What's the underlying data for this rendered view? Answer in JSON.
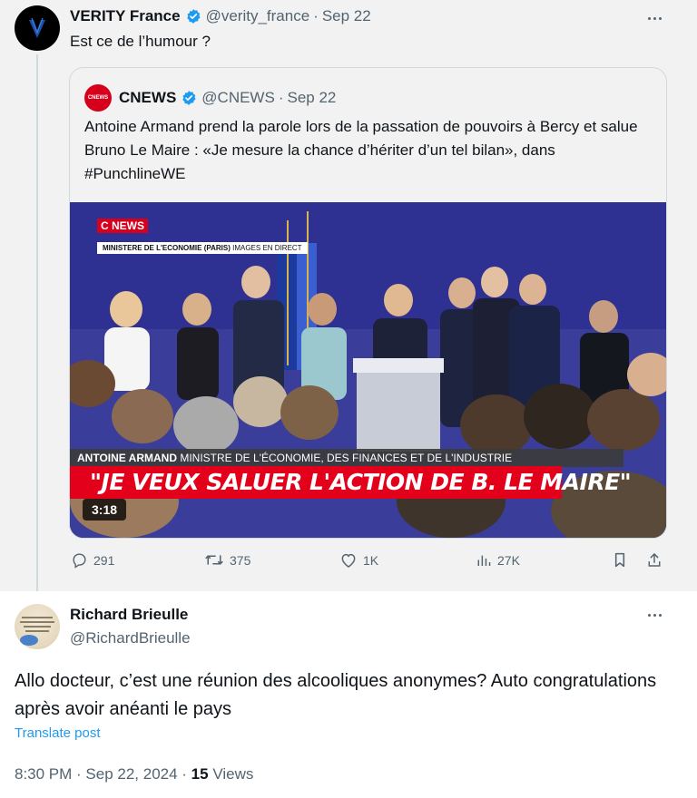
{
  "parent_tweet": {
    "name": "VERITY France",
    "handle": "@verity_france",
    "date": "Sep 22",
    "text": "Est ce de l’humour ?"
  },
  "quoted_tweet": {
    "name": "CNEWS",
    "avatar_label": "CNEWS",
    "handle": "@CNEWS",
    "date": "Sep 22",
    "text": "Antoine Armand prend la parole lors de la passation de pouvoirs à Bercy et salue Bruno Le Maire : «Je mesure la chance d’hériter d’un tel bilan», dans #PunchlineWE",
    "video": {
      "channel_logo": "C NEWS",
      "location_bold": "MINISTERE DE L'ECONOMIE (PARIS)",
      "location_light": "IMAGES EN DIRECT",
      "speaker_name": "ANTOINE ARMAND",
      "speaker_title": "MINISTRE DE L'ÉCONOMIE, DES FINANCES ET DE L'INDUSTRIE",
      "headline": "\"JE VEUX SALUER L'ACTION DE B. LE MAIRE\"",
      "duration": "3:18"
    }
  },
  "actions": {
    "replies": "291",
    "reposts": "375",
    "likes": "1K",
    "views": "27K"
  },
  "reply_tweet": {
    "name": "Richard Brieulle",
    "handle": "@RichardBrieulle",
    "text": "Allo docteur, c’est une réunion des alcooliques anonymes? Auto congratulations après avoir anéanti le pays",
    "translate_label": "Translate post",
    "time": "8:30 PM · Sep 22, 2024 · ",
    "views_count": "15",
    "views_label": " Views"
  },
  "colors": {
    "accent": "#1d9bf0",
    "muted": "#536471",
    "cnews_red": "#d6001c"
  }
}
